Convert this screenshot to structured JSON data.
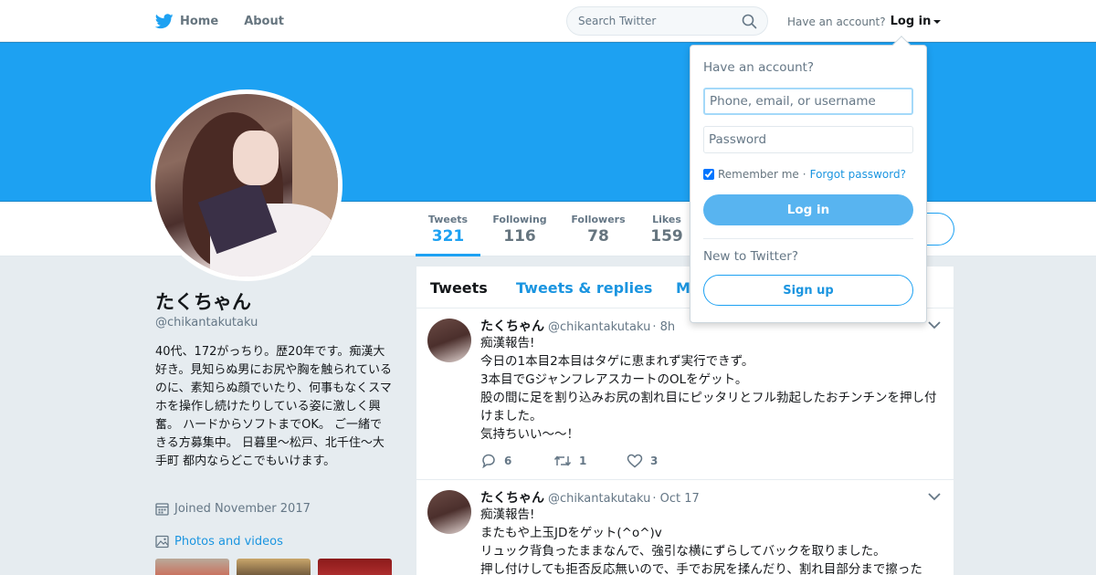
{
  "nav": {
    "home": "Home",
    "about": "About",
    "search_placeholder": "Search Twitter",
    "have_account": "Have an account?",
    "login": "Log in"
  },
  "profile": {
    "name": "たくちゃん",
    "handle": "@chikantakutaku",
    "bio": "40代、172がっちり。歴20年です。痴漢大好き。見知らぬ男にお尻や胸を触られているのに、素知らぬ顔でいたり、何事もなくスマホを操作し続けたりしている姿に激しく興奮。 ハードからソフトまでOK。 ご一緒できる方募集中。 日暮里～松戸、北千住～大手町 都内ならどこでもいけます。",
    "joined": "Joined November 2017",
    "photos": "Photos and videos"
  },
  "stats": [
    {
      "label": "Tweets",
      "value": "321"
    },
    {
      "label": "Following",
      "value": "116"
    },
    {
      "label": "Followers",
      "value": "78"
    },
    {
      "label": "Likes",
      "value": "159"
    }
  ],
  "tabs": {
    "tweets": "Tweets",
    "replies": "Tweets & replies",
    "media": "M"
  },
  "tweets": [
    {
      "name": "たくちゃん",
      "handle": "@chikantakutaku",
      "time": "· 8h",
      "lines": [
        "痴漢報告!",
        "今日の1本目2本目はタゲに恵まれず実行できず。",
        "3本目でGジャンフレアスカートのOLをゲット。",
        "股の間に足を割り込みお尻の割れ目にピッタリとフル勃起したおチンチンを押し付けました。",
        "気持ちいい〜〜！"
      ],
      "replies": "6",
      "retweets": "1",
      "likes": "3"
    },
    {
      "name": "たくちゃん",
      "handle": "@chikantakutaku",
      "time": "· Oct 17",
      "lines": [
        "痴漢報告!",
        "またもや上玉JDをゲット(^o^)v",
        "リュック背負ったままなんで、強引な横にずらしてバックを取りました。",
        "押し付けしても拒否反応無いので、手でお尻を揉んだり、割れ目部分まで擦った"
      ]
    }
  ],
  "dropdown": {
    "title": "Have an account?",
    "username_placeholder": "Phone, email, or username",
    "password_placeholder": "Password",
    "remember": "Remember me",
    "dot": "·",
    "forgot": "Forgot password?",
    "login_button": "Log in",
    "new_to": "New to Twitter?",
    "signup_button": "Sign up"
  },
  "colors": {
    "brand": "#1da1f2",
    "link": "#1b95e0",
    "background": "#e6ecf0"
  }
}
